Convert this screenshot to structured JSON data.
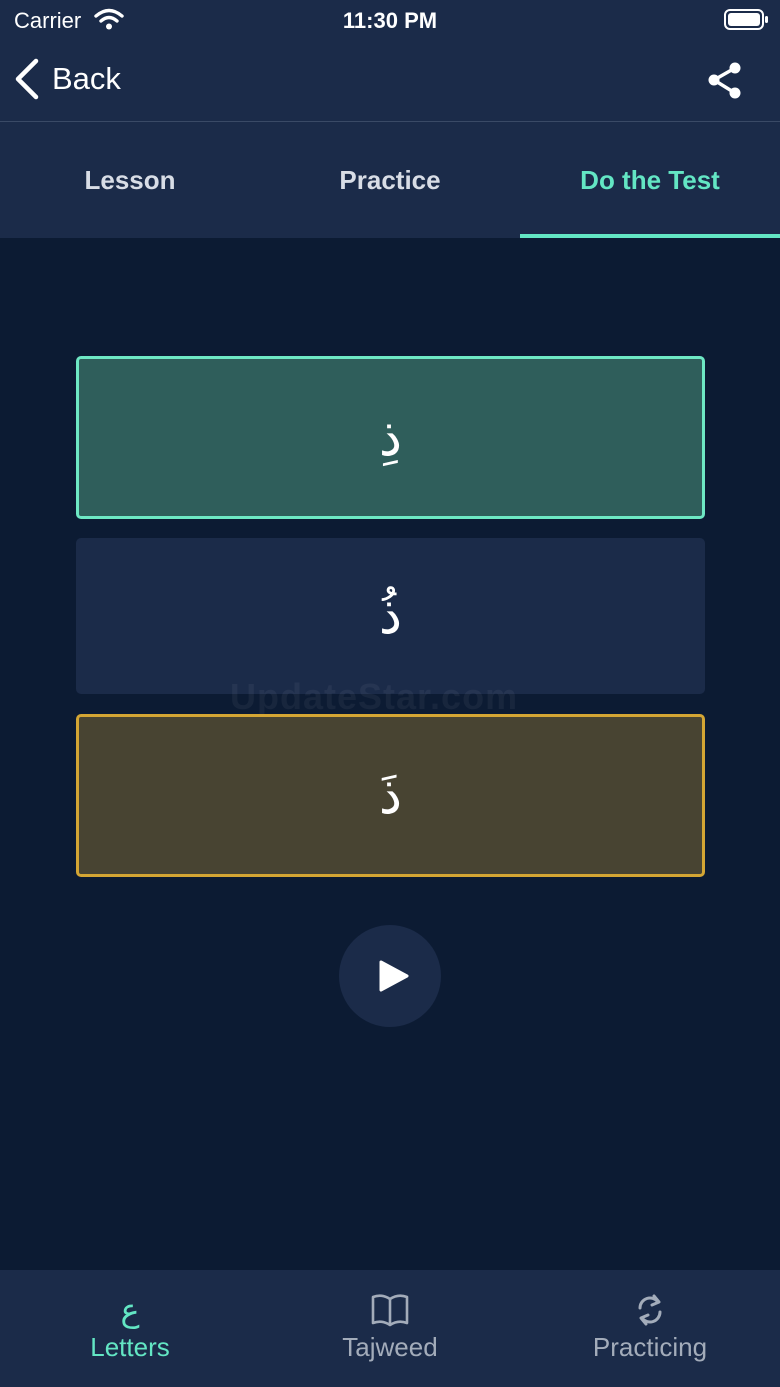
{
  "status_bar": {
    "carrier": "Carrier",
    "time": "11:30 PM",
    "icons": [
      "wifi-icon",
      "battery-icon"
    ]
  },
  "nav": {
    "back_label": "Back",
    "icons": [
      "chevron-left-icon",
      "share-icon"
    ]
  },
  "tabs": [
    {
      "label": "Lesson",
      "active": false
    },
    {
      "label": "Practice",
      "active": false
    },
    {
      "label": "Do the Test",
      "active": true
    }
  ],
  "test": {
    "options": [
      {
        "text": "ذِ",
        "state": "correct"
      },
      {
        "text": "ذُ",
        "state": "neutral"
      },
      {
        "text": "ذَ",
        "state": "selected"
      }
    ],
    "play_icon": "play-icon",
    "watermark": "UpdateStar.com"
  },
  "bottom_tabs": [
    {
      "label": "Letters",
      "icon": "ع",
      "active": true
    },
    {
      "label": "Tajweed",
      "icon": "book-icon",
      "active": false
    },
    {
      "label": "Practicing",
      "icon": "refresh-icon",
      "active": false
    }
  ],
  "colors": {
    "background": "#0c1b33",
    "bar": "#1b2b49",
    "accent": "#63e6c4",
    "correct_fill": "#2f5e5b",
    "selected_border": "#d4a634",
    "selected_fill": "#484432"
  }
}
